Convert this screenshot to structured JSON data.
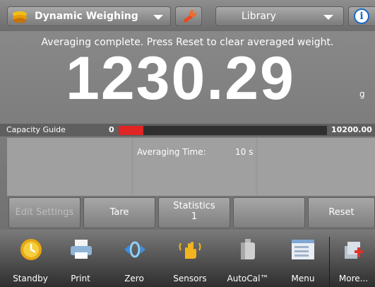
{
  "topbar": {
    "app_name": "Dynamic Weighing",
    "app_icon": "scale-pan-icon",
    "settings_icon": "wrench-icon",
    "library_label": "Library",
    "info_icon": "info-icon",
    "info_glyph": "i"
  },
  "status_message": "Averaging complete.  Press Reset to clear averaged weight.",
  "weight": {
    "value": "1230.29",
    "unit": "g"
  },
  "capacity_guide": {
    "label": "Capacity Guide",
    "min": "0",
    "max": "10200.00",
    "fill_fraction": 0.12,
    "fill_color": "#e12424"
  },
  "data_fields": {
    "averaging_time_label": "Averaging Time:",
    "averaging_time_value": "10 s"
  },
  "softkeys": {
    "edit_settings": "Edit Settings",
    "tare": "Tare",
    "statistics_label": "Statistics",
    "statistics_value": "1",
    "reset": "Reset"
  },
  "nav": {
    "standby": "Standby",
    "print": "Print",
    "zero": "Zero",
    "sensors": "Sensors",
    "autocal": "AutoCal™",
    "menu": "Menu",
    "more": "More..."
  },
  "colors": {
    "accent_blue": "#1769c7",
    "capacity_red": "#e12424"
  }
}
